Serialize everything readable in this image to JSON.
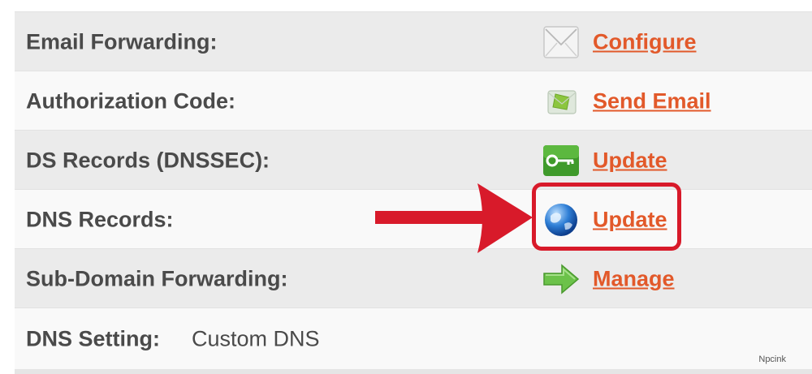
{
  "rows": [
    {
      "label": "Email Forwarding:",
      "action": "Configure",
      "icon": "envelope-icon"
    },
    {
      "label": "Authorization Code:",
      "action": "Send Email",
      "icon": "send-email-icon"
    },
    {
      "label": "DS Records (DNSSEC):",
      "action": "Update",
      "icon": "key-icon"
    },
    {
      "label": "DNS Records:",
      "action": "Update",
      "icon": "globe-icon"
    },
    {
      "label": "Sub-Domain Forwarding:",
      "action": "Manage",
      "icon": "green-arrow-icon"
    },
    {
      "label": "DNS Setting:",
      "value": "Custom DNS"
    }
  ],
  "watermark": "Npcink",
  "colors": {
    "link": "#e2592a",
    "highlight": "#d81a2a",
    "row_gray": "#ebebeb",
    "label": "#4a4a4a"
  }
}
